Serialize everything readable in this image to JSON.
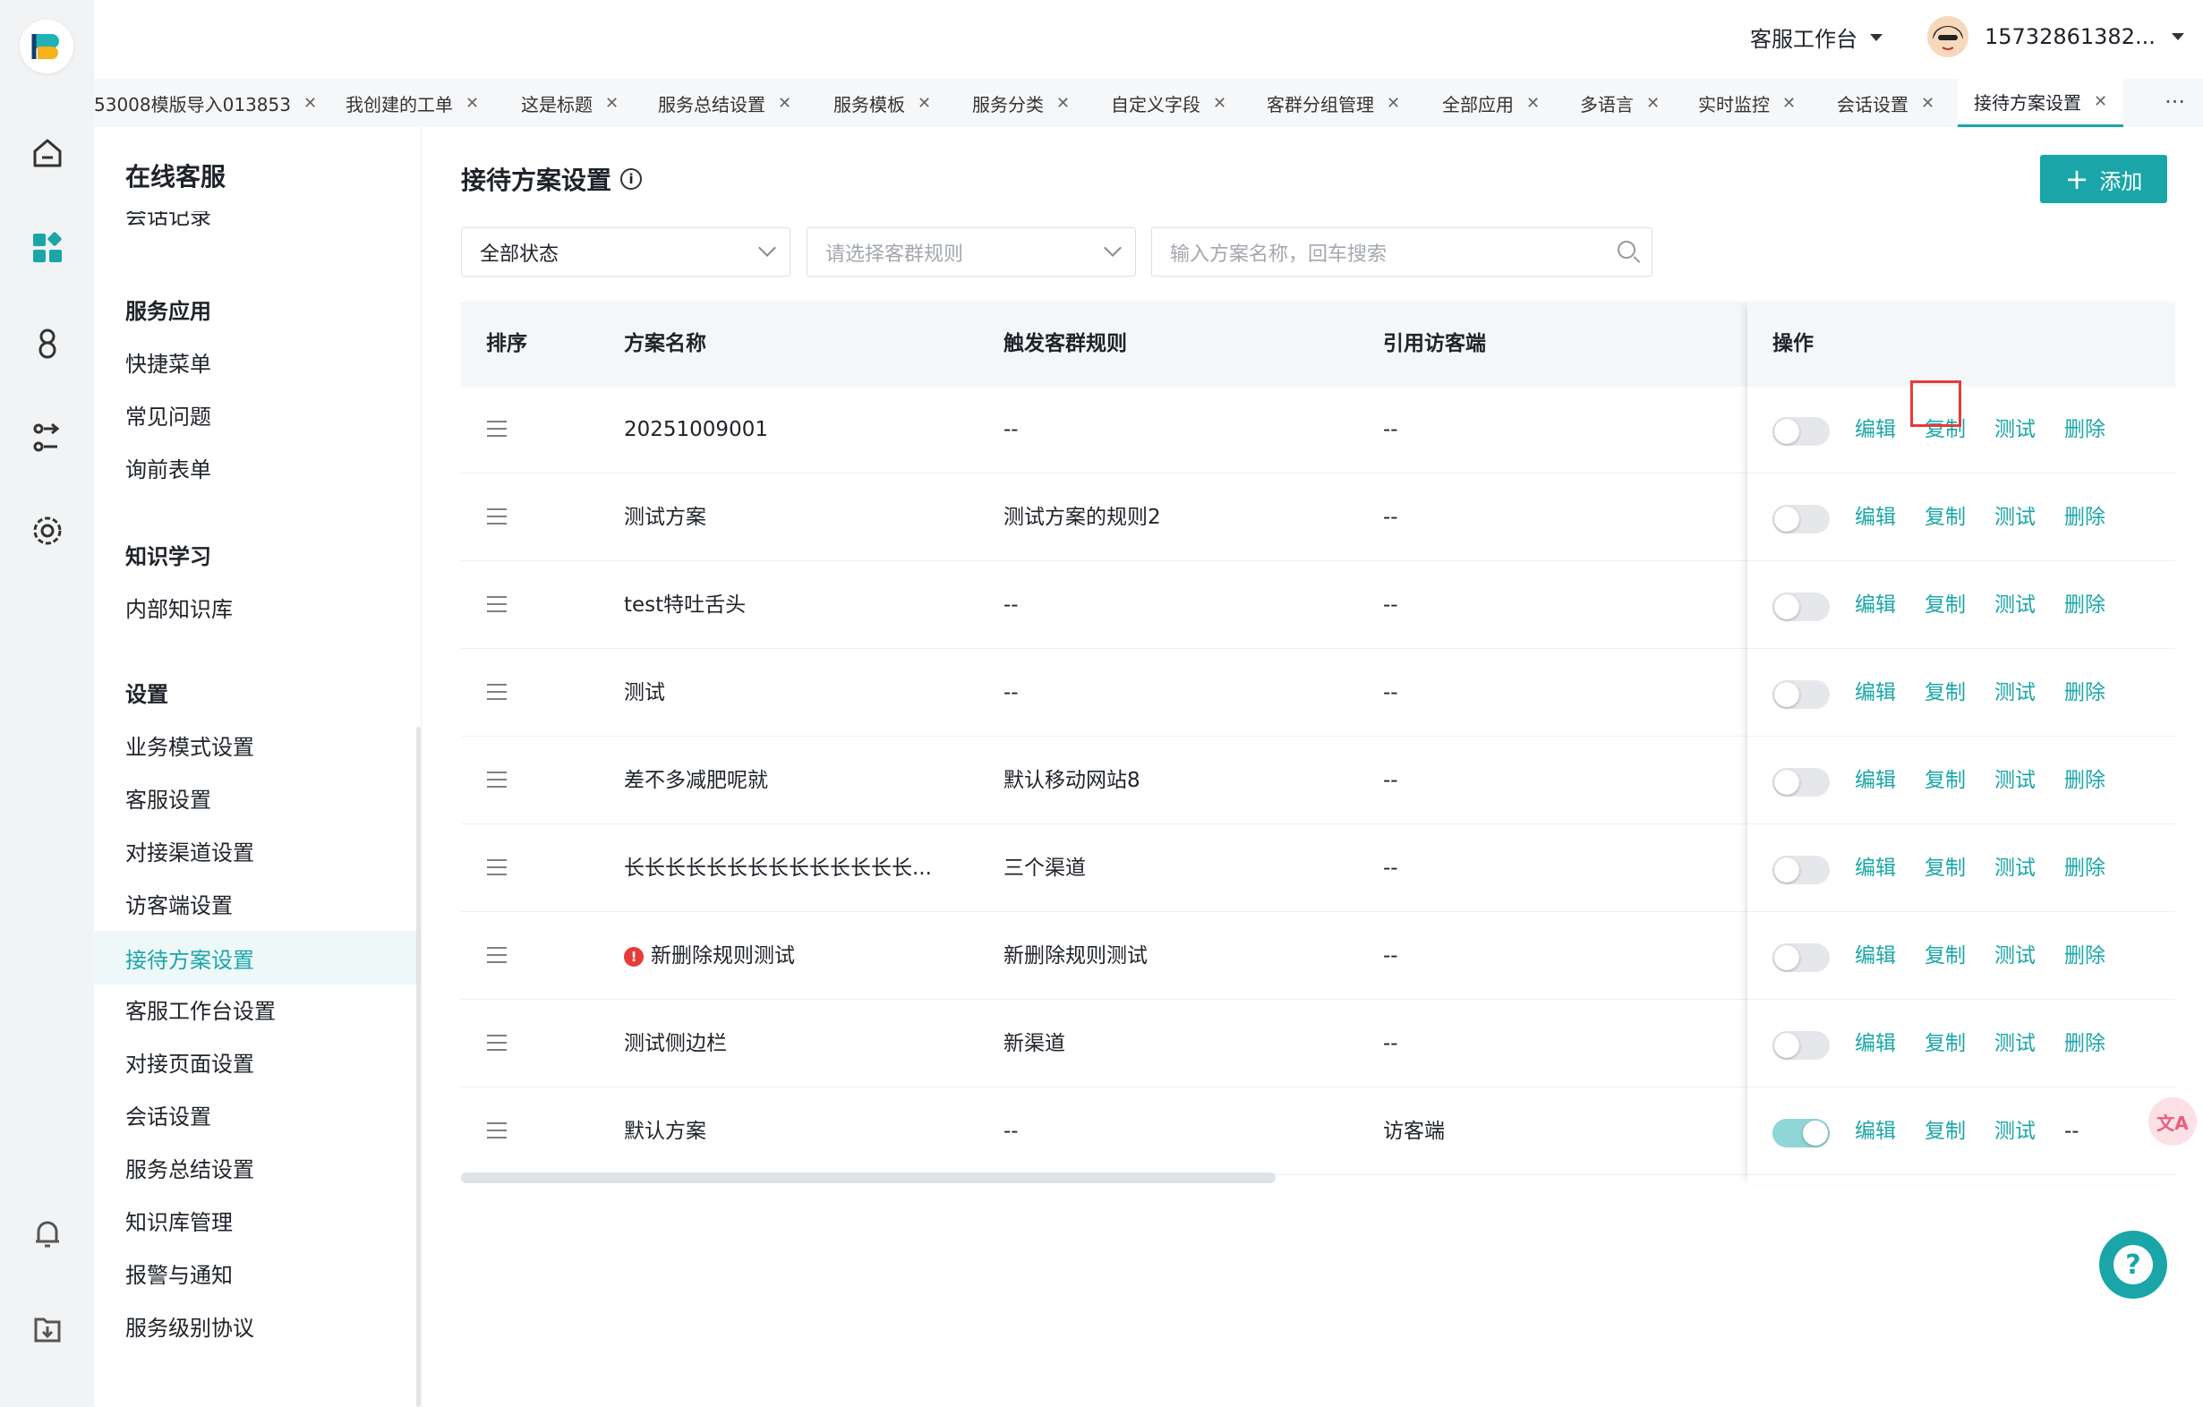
{
  "header": {
    "workspace": "客服工作台",
    "username": "15732861382..."
  },
  "tabs": [
    {
      "label": "53008模版导入013853"
    },
    {
      "label": "我创建的工单"
    },
    {
      "label": "这是标题"
    },
    {
      "label": "服务总结设置"
    },
    {
      "label": "服务模板"
    },
    {
      "label": "服务分类"
    },
    {
      "label": "自定义字段"
    },
    {
      "label": "客群分组管理"
    },
    {
      "label": "全部应用"
    },
    {
      "label": "多语言"
    },
    {
      "label": "实时监控"
    },
    {
      "label": "会话设置"
    },
    {
      "label": "接待方案设置"
    }
  ],
  "tabs_more": "···",
  "sidebar": {
    "title": "在线客服",
    "cut_item": "会话记录",
    "groups": [
      {
        "head": "服务应用",
        "items": [
          "快捷菜单",
          "常见问题",
          "询前表单"
        ]
      },
      {
        "head": "知识学习",
        "items": [
          "内部知识库"
        ]
      },
      {
        "head": "设置",
        "items": [
          "业务模式设置",
          "客服设置",
          "对接渠道设置",
          "访客端设置",
          "接待方案设置",
          "客服工作台设置",
          "对接页面设置",
          "会话设置",
          "服务总结设置",
          "知识库管理",
          "报警与通知",
          "服务级别协议"
        ]
      }
    ],
    "active": "接待方案设置"
  },
  "main": {
    "title": "接待方案设置",
    "info_glyph": "i",
    "add_label": "添加",
    "filters": {
      "status": "全部状态",
      "rule_placeholder": "请选择客群规则",
      "search_placeholder": "输入方案名称，回车搜索"
    },
    "columns": [
      "排序",
      "方案名称",
      "触发客群规则",
      "引用访客端",
      "操作"
    ],
    "rows": [
      {
        "name": "20251009001",
        "rule": "--",
        "client": "--",
        "enabled": false,
        "warn": false,
        "delete": "删除"
      },
      {
        "name": "测试方案",
        "rule": "测试方案的规则2",
        "client": "--",
        "enabled": false,
        "warn": false,
        "delete": "删除"
      },
      {
        "name": "test特吐舌头",
        "rule": "--",
        "client": "--",
        "enabled": false,
        "warn": false,
        "delete": "删除"
      },
      {
        "name": "测试",
        "rule": "--",
        "client": "--",
        "enabled": false,
        "warn": false,
        "delete": "删除"
      },
      {
        "name": "差不多减肥呢就",
        "rule": "默认移动网站8",
        "client": "--",
        "enabled": false,
        "warn": false,
        "delete": "删除"
      },
      {
        "name": "长长长长长长长长长长长长长长...",
        "rule": "三个渠道",
        "client": "--",
        "enabled": false,
        "warn": false,
        "delete": "删除"
      },
      {
        "name": "新删除规则测试",
        "rule": "新删除规则测试",
        "client": "--",
        "enabled": false,
        "warn": true,
        "delete": "删除"
      },
      {
        "name": "测试侧边栏",
        "rule": "新渠道",
        "client": "--",
        "enabled": false,
        "warn": false,
        "delete": "删除"
      },
      {
        "name": "默认方案",
        "rule": "--",
        "client": "访客端",
        "enabled": true,
        "warn": false,
        "delete": "--"
      }
    ],
    "ops": {
      "edit": "编辑",
      "copy": "复制",
      "test": "测试"
    },
    "warn_glyph": "!"
  },
  "fabs": {
    "translate_glyph": "文A",
    "help_glyph": "?"
  },
  "colors": {
    "accent": "#1aa6a8",
    "highlight": "#e83a3a"
  }
}
